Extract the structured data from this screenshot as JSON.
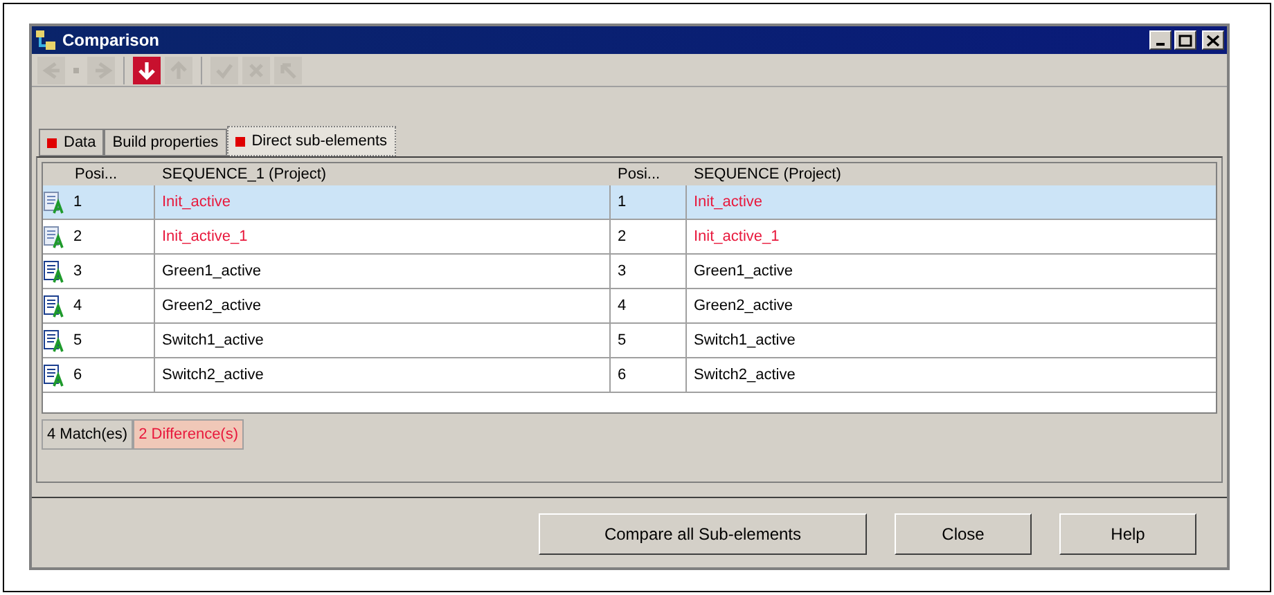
{
  "window": {
    "title": "Comparison"
  },
  "toolbar": [
    {
      "kind": "back",
      "disabled": true
    },
    {
      "kind": "dot",
      "disabled": true
    },
    {
      "kind": "forward",
      "disabled": true
    },
    {
      "kind": "down",
      "disabled": false
    },
    {
      "kind": "up",
      "disabled": true
    },
    {
      "kind": "check",
      "disabled": true
    },
    {
      "kind": "cross",
      "disabled": true
    },
    {
      "kind": "jump",
      "disabled": true
    }
  ],
  "tabs": [
    {
      "label": "Data",
      "flag": true,
      "selected": false
    },
    {
      "label": "Build properties",
      "flag": false,
      "selected": false
    },
    {
      "label": "Direct sub-elements",
      "flag": true,
      "selected": true
    }
  ],
  "table": {
    "columns": [
      "Posi...",
      "SEQUENCE_1 (Project)",
      "Posi...",
      "SEQUENCE (Project)"
    ],
    "rows": [
      {
        "kind": "different",
        "selected": true,
        "cells": [
          "1",
          "Init_active",
          "1",
          "Init_active"
        ]
      },
      {
        "kind": "different",
        "selected": false,
        "cells": [
          "2",
          "Init_active_1",
          "2",
          "Init_active_1"
        ]
      },
      {
        "kind": "match",
        "selected": false,
        "cells": [
          "3",
          "Green1_active",
          "3",
          "Green1_active"
        ]
      },
      {
        "kind": "match",
        "selected": false,
        "cells": [
          "4",
          "Green2_active",
          "4",
          "Green2_active"
        ]
      },
      {
        "kind": "match",
        "selected": false,
        "cells": [
          "5",
          "Switch1_active",
          "5",
          "Switch1_active"
        ]
      },
      {
        "kind": "match",
        "selected": false,
        "cells": [
          "6",
          "Switch2_active",
          "6",
          "Switch2_active"
        ]
      }
    ]
  },
  "filter_tabs": [
    {
      "label": "4 Match(es)",
      "kind": "match",
      "selected": false
    },
    {
      "label": "2 Difference(s)",
      "kind": "different",
      "selected": true
    }
  ],
  "buttons": [
    "Compare all Sub-elements",
    "Close",
    "Help"
  ]
}
